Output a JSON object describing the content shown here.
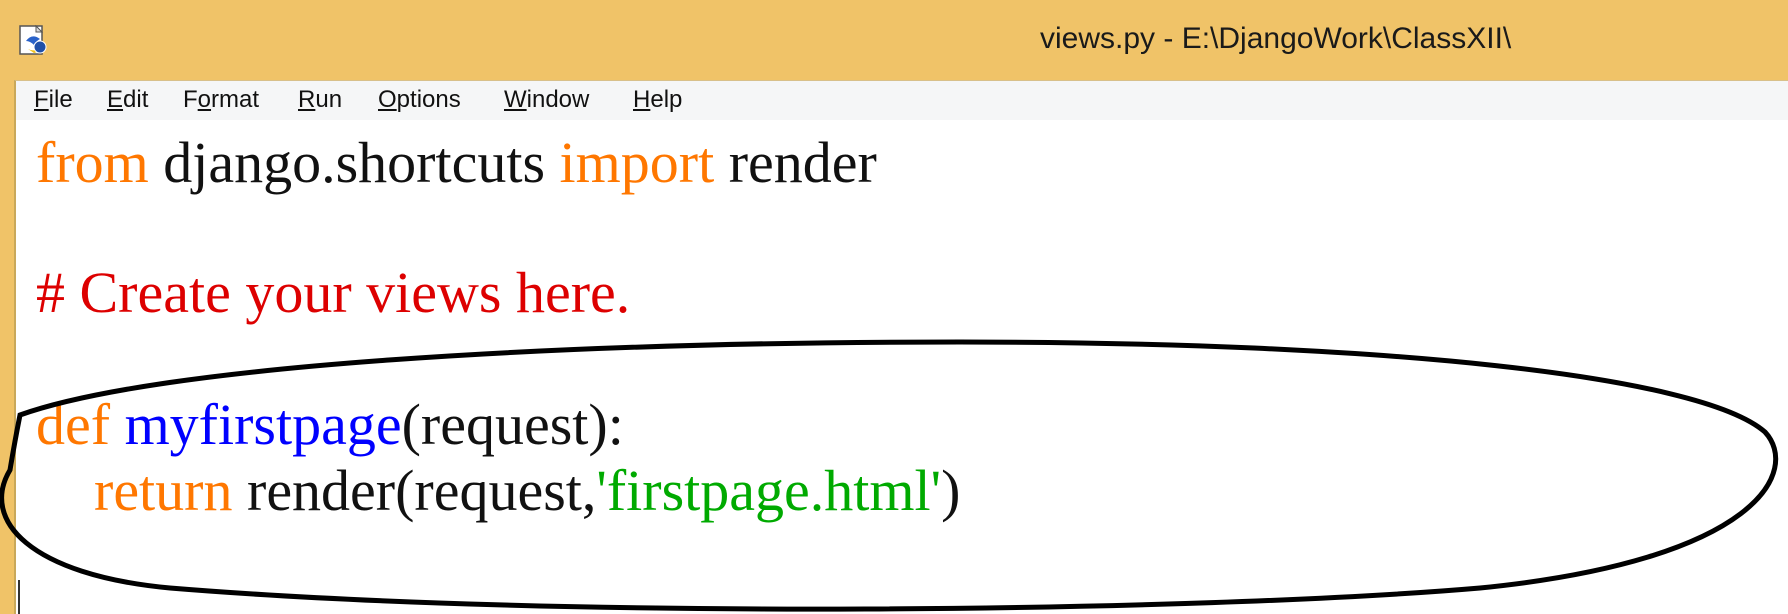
{
  "window": {
    "title": "views.py - E:\\DjangoWork\\ClassXII\\",
    "icon": "python-idle-icon"
  },
  "menubar": {
    "items": [
      {
        "label": "File",
        "mnemonic": "F",
        "rest": "ile"
      },
      {
        "label": "Edit",
        "mnemonic": "E",
        "rest": "dit"
      },
      {
        "label": "Format",
        "pre": "F",
        "mnemonic": "o",
        "rest": "rmat"
      },
      {
        "label": "Run",
        "mnemonic": "R",
        "rest": "un"
      },
      {
        "label": "Options",
        "mnemonic": "O",
        "rest": "ptions"
      },
      {
        "label": "Window",
        "mnemonic": "W",
        "rest": "indow"
      },
      {
        "label": "Help",
        "mnemonic": "H",
        "rest": "elp"
      }
    ]
  },
  "editor": {
    "lines": [
      {
        "tokens": [
          {
            "text": "from",
            "kind": "kw"
          },
          {
            "text": " django.shortcuts ",
            "kind": "pl"
          },
          {
            "text": "import",
            "kind": "kw"
          },
          {
            "text": " render",
            "kind": "pl"
          }
        ]
      },
      {
        "tokens": [
          {
            "text": "# Create your views here.",
            "kind": "cm"
          }
        ]
      },
      {
        "tokens": [
          {
            "text": "def",
            "kind": "kw"
          },
          {
            "text": " ",
            "kind": "pl"
          },
          {
            "text": "myfirstpage",
            "kind": "df"
          },
          {
            "text": "(request):",
            "kind": "pl"
          }
        ]
      },
      {
        "tokens": [
          {
            "text": "    ",
            "kind": "pl"
          },
          {
            "text": "return",
            "kind": "kw"
          },
          {
            "text": " render(request,",
            "kind": "pl"
          },
          {
            "text": "'firstpage.html'",
            "kind": "st"
          },
          {
            "text": ")",
            "kind": "pl"
          }
        ]
      }
    ]
  },
  "colors": {
    "titlebar": "#f0c368",
    "keyword": "#ff7700",
    "comment": "#dd0000",
    "string": "#00aa00",
    "definition": "#0000ff"
  }
}
